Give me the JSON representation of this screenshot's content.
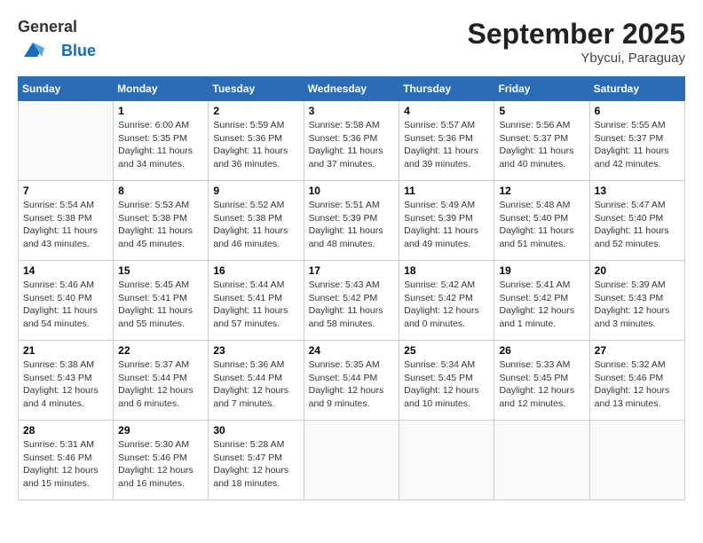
{
  "header": {
    "logo_general": "General",
    "logo_blue": "Blue",
    "month": "September 2025",
    "location": "Ybycui, Paraguay"
  },
  "days_of_week": [
    "Sunday",
    "Monday",
    "Tuesday",
    "Wednesday",
    "Thursday",
    "Friday",
    "Saturday"
  ],
  "weeks": [
    [
      {
        "day": "",
        "info": ""
      },
      {
        "day": "1",
        "info": "Sunrise: 6:00 AM\nSunset: 5:35 PM\nDaylight: 11 hours\nand 34 minutes."
      },
      {
        "day": "2",
        "info": "Sunrise: 5:59 AM\nSunset: 5:36 PM\nDaylight: 11 hours\nand 36 minutes."
      },
      {
        "day": "3",
        "info": "Sunrise: 5:58 AM\nSunset: 5:36 PM\nDaylight: 11 hours\nand 37 minutes."
      },
      {
        "day": "4",
        "info": "Sunrise: 5:57 AM\nSunset: 5:36 PM\nDaylight: 11 hours\nand 39 minutes."
      },
      {
        "day": "5",
        "info": "Sunrise: 5:56 AM\nSunset: 5:37 PM\nDaylight: 11 hours\nand 40 minutes."
      },
      {
        "day": "6",
        "info": "Sunrise: 5:55 AM\nSunset: 5:37 PM\nDaylight: 11 hours\nand 42 minutes."
      }
    ],
    [
      {
        "day": "7",
        "info": "Sunrise: 5:54 AM\nSunset: 5:38 PM\nDaylight: 11 hours\nand 43 minutes."
      },
      {
        "day": "8",
        "info": "Sunrise: 5:53 AM\nSunset: 5:38 PM\nDaylight: 11 hours\nand 45 minutes."
      },
      {
        "day": "9",
        "info": "Sunrise: 5:52 AM\nSunset: 5:38 PM\nDaylight: 11 hours\nand 46 minutes."
      },
      {
        "day": "10",
        "info": "Sunrise: 5:51 AM\nSunset: 5:39 PM\nDaylight: 11 hours\nand 48 minutes."
      },
      {
        "day": "11",
        "info": "Sunrise: 5:49 AM\nSunset: 5:39 PM\nDaylight: 11 hours\nand 49 minutes."
      },
      {
        "day": "12",
        "info": "Sunrise: 5:48 AM\nSunset: 5:40 PM\nDaylight: 11 hours\nand 51 minutes."
      },
      {
        "day": "13",
        "info": "Sunrise: 5:47 AM\nSunset: 5:40 PM\nDaylight: 11 hours\nand 52 minutes."
      }
    ],
    [
      {
        "day": "14",
        "info": "Sunrise: 5:46 AM\nSunset: 5:40 PM\nDaylight: 11 hours\nand 54 minutes."
      },
      {
        "day": "15",
        "info": "Sunrise: 5:45 AM\nSunset: 5:41 PM\nDaylight: 11 hours\nand 55 minutes."
      },
      {
        "day": "16",
        "info": "Sunrise: 5:44 AM\nSunset: 5:41 PM\nDaylight: 11 hours\nand 57 minutes."
      },
      {
        "day": "17",
        "info": "Sunrise: 5:43 AM\nSunset: 5:42 PM\nDaylight: 11 hours\nand 58 minutes."
      },
      {
        "day": "18",
        "info": "Sunrise: 5:42 AM\nSunset: 5:42 PM\nDaylight: 12 hours\nand 0 minutes."
      },
      {
        "day": "19",
        "info": "Sunrise: 5:41 AM\nSunset: 5:42 PM\nDaylight: 12 hours\nand 1 minute."
      },
      {
        "day": "20",
        "info": "Sunrise: 5:39 AM\nSunset: 5:43 PM\nDaylight: 12 hours\nand 3 minutes."
      }
    ],
    [
      {
        "day": "21",
        "info": "Sunrise: 5:38 AM\nSunset: 5:43 PM\nDaylight: 12 hours\nand 4 minutes."
      },
      {
        "day": "22",
        "info": "Sunrise: 5:37 AM\nSunset: 5:44 PM\nDaylight: 12 hours\nand 6 minutes."
      },
      {
        "day": "23",
        "info": "Sunrise: 5:36 AM\nSunset: 5:44 PM\nDaylight: 12 hours\nand 7 minutes."
      },
      {
        "day": "24",
        "info": "Sunrise: 5:35 AM\nSunset: 5:44 PM\nDaylight: 12 hours\nand 9 minutes."
      },
      {
        "day": "25",
        "info": "Sunrise: 5:34 AM\nSunset: 5:45 PM\nDaylight: 12 hours\nand 10 minutes."
      },
      {
        "day": "26",
        "info": "Sunrise: 5:33 AM\nSunset: 5:45 PM\nDaylight: 12 hours\nand 12 minutes."
      },
      {
        "day": "27",
        "info": "Sunrise: 5:32 AM\nSunset: 5:46 PM\nDaylight: 12 hours\nand 13 minutes."
      }
    ],
    [
      {
        "day": "28",
        "info": "Sunrise: 5:31 AM\nSunset: 5:46 PM\nDaylight: 12 hours\nand 15 minutes."
      },
      {
        "day": "29",
        "info": "Sunrise: 5:30 AM\nSunset: 5:46 PM\nDaylight: 12 hours\nand 16 minutes."
      },
      {
        "day": "30",
        "info": "Sunrise: 5:28 AM\nSunset: 5:47 PM\nDaylight: 12 hours\nand 18 minutes."
      },
      {
        "day": "",
        "info": ""
      },
      {
        "day": "",
        "info": ""
      },
      {
        "day": "",
        "info": ""
      },
      {
        "day": "",
        "info": ""
      }
    ]
  ]
}
